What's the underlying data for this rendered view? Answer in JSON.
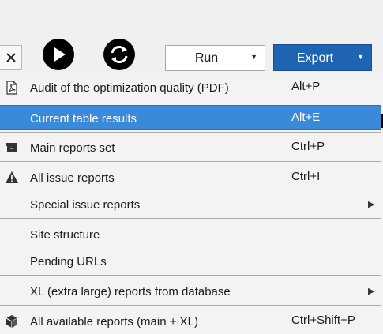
{
  "toolbar": {
    "run_label": "Run",
    "export_label": "Export",
    "export_color": "#1f64b3"
  },
  "menu": {
    "selected_color": "#3b8ad9",
    "items": [
      {
        "label": "Audit of the optimization quality (PDF)",
        "shortcut": "Alt+P",
        "icon": "pdf-icon"
      },
      {
        "label": "Current table results",
        "shortcut": "Alt+E",
        "icon": ""
      },
      {
        "label": "Main reports set",
        "shortcut": "Ctrl+P",
        "icon": "archive-box-icon"
      },
      {
        "label": "All issue reports",
        "shortcut": "Ctrl+I",
        "icon": "warning-icon"
      },
      {
        "label": "Special issue reports",
        "shortcut": "",
        "icon": "",
        "submenu": true
      },
      {
        "label": "Site structure",
        "shortcut": "",
        "icon": ""
      },
      {
        "label": "Pending URLs",
        "shortcut": "",
        "icon": ""
      },
      {
        "label": "XL (extra large) reports from database",
        "shortcut": "",
        "icon": "",
        "submenu": true
      },
      {
        "label": "All available reports (main + XL)",
        "shortcut": "Ctrl+Shift+P",
        "icon": "cube-icon"
      }
    ]
  }
}
